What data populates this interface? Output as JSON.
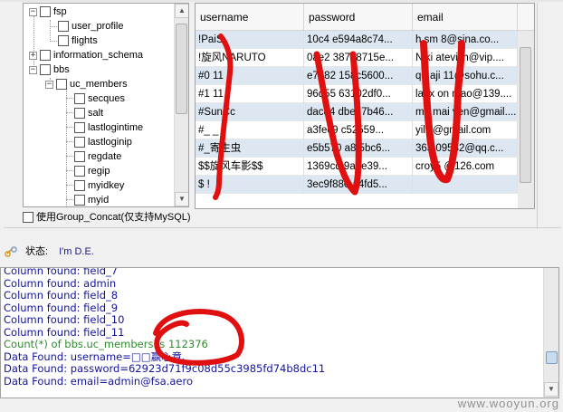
{
  "tree": {
    "items": [
      {
        "label": "fsp",
        "level": 0,
        "expander": "−",
        "checkbox": true
      },
      {
        "label": "user_profile",
        "level": 1,
        "expander": "",
        "checkbox": true
      },
      {
        "label": "flights",
        "level": 1,
        "expander": "",
        "checkbox": true
      },
      {
        "label": "information_schema",
        "level": 0,
        "expander": "+",
        "checkbox": true
      },
      {
        "label": "bbs",
        "level": 0,
        "expander": "−",
        "checkbox": true
      },
      {
        "label": "uc_members",
        "level": 1,
        "expander": "−",
        "checkbox": true
      },
      {
        "label": "secques",
        "level": 2,
        "expander": "",
        "checkbox": true
      },
      {
        "label": "salt",
        "level": 2,
        "expander": "",
        "checkbox": true
      },
      {
        "label": "lastlogintime",
        "level": 2,
        "expander": "",
        "checkbox": true
      },
      {
        "label": "lastloginip",
        "level": 2,
        "expander": "",
        "checkbox": true
      },
      {
        "label": "regdate",
        "level": 2,
        "expander": "",
        "checkbox": true
      },
      {
        "label": "regip",
        "level": 2,
        "expander": "",
        "checkbox": true
      },
      {
        "label": "myidkey",
        "level": 2,
        "expander": "",
        "checkbox": true
      },
      {
        "label": "myid",
        "level": 2,
        "expander": "",
        "checkbox": true
      }
    ]
  },
  "group_concat_label": "使用Group_Concat(仅支持MySQL)",
  "grid": {
    "columns": [
      "username",
      "password",
      "email"
    ],
    "rows": [
      [
        "!PaiS",
        "10c4 e594a8c74...",
        "h  sm  8@sina.co..."
      ],
      [
        "!旋风NARUTO",
        "0ae2  38728715e...",
        "Niki  atevich@vip...."
      ],
      [
        "#0  11",
        "e7682  158c5600...",
        "qq  aji  11@sohu.c..."
      ],
      [
        "#1  11",
        "96d55  63102df0...",
        "lanx  on  mao@139...."
      ],
      [
        "#SunCc",
        "dac84  dbe37b46...",
        "ma  mai  ven@gmail...."
      ],
      [
        "#_  _",
        "a3fec9  c52559...",
        "yilil  @gmail.com"
      ],
      [
        "#_寄生虫",
        "e5b570  a8f5bc6...",
        "363  09582@qq.c..."
      ],
      [
        "$$旋风车影$$",
        "1369cd  9a0e39...",
        "croy5  @126.com"
      ],
      [
        "$  !",
        "3ec9f880  a4fd5...",
        ""
      ]
    ]
  },
  "status": {
    "label": "状态:",
    "text": "I'm D.E."
  },
  "log": {
    "lines": [
      {
        "text": "Column found: field_7",
        "color": "blue"
      },
      {
        "text": "Column found: admin",
        "color": "blue"
      },
      {
        "text": "Column found: field_8",
        "color": "blue"
      },
      {
        "text": "Column found: field_9",
        "color": "blue"
      },
      {
        "text": "Column found: field_10",
        "color": "blue"
      },
      {
        "text": "Column found: field_11",
        "color": "blue"
      },
      {
        "text": "Count(*) of bbs.uc_members is 112376",
        "color": "green"
      },
      {
        "text": "Data Found: username=□□赢心意、",
        "color": "blue"
      },
      {
        "text": "Data Found: password=62923d71f9c08d55c3985fd74b8dc11",
        "color": "blue"
      },
      {
        "text": "Data Found: email=admin@fsa.aero",
        "color": "blue"
      }
    ]
  },
  "watermark": "www.wooyun.org",
  "colors": {
    "log_blue": "#1414a0",
    "log_green": "#2e8b2e",
    "marker_red": "#e01010",
    "row_alt": "#dce7f1"
  }
}
